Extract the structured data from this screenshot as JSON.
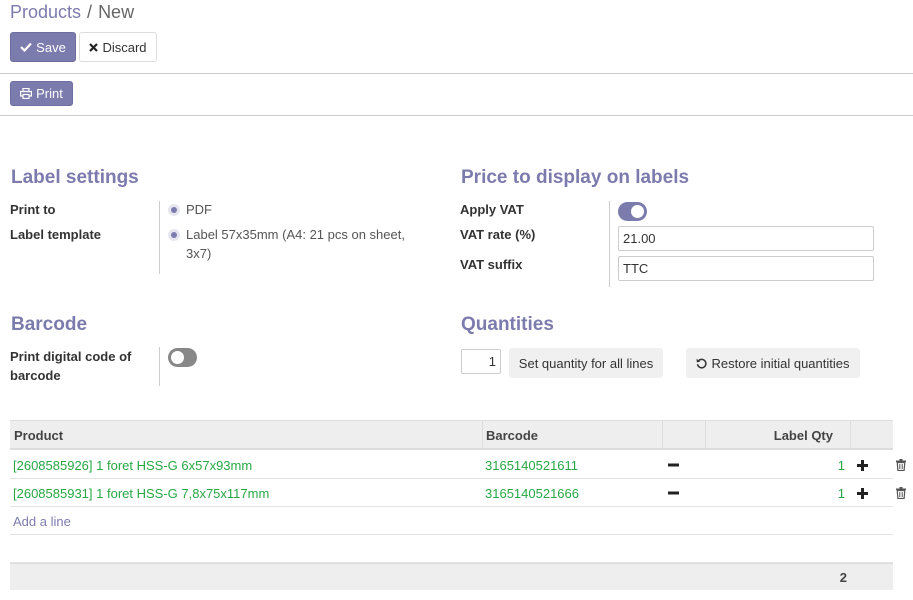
{
  "breadcrumb": {
    "parent": "Products",
    "separator": "/",
    "current": "New"
  },
  "control_panel": {
    "save_label": "Save",
    "discard_label": "Discard",
    "print_label": "Print"
  },
  "label_settings": {
    "title": "Label settings",
    "print_to_label": "Print to",
    "print_to_value": "PDF",
    "template_label": "Label template",
    "template_value_line1": "Label 57x35mm (A4: 21 pcs on sheet,",
    "template_value_line2": "3x7)"
  },
  "price_display": {
    "title": "Price to display on labels",
    "apply_vat_label": "Apply VAT",
    "apply_vat_on": true,
    "vat_rate_label": "VAT rate (%)",
    "vat_rate_value": "21.00",
    "vat_suffix_label": "VAT suffix",
    "vat_suffix_value": "TTC"
  },
  "barcode": {
    "title": "Barcode",
    "print_digital_label_line1": "Print digital code of",
    "print_digital_label_line2": "barcode",
    "print_digital_on": false
  },
  "quantities": {
    "title": "Quantities",
    "qty_value": "1",
    "set_all_label": "Set quantity for all lines",
    "restore_label": "Restore initial quantities"
  },
  "table": {
    "columns": {
      "product": "Product",
      "barcode": "Barcode",
      "label_qty": "Label Qty"
    },
    "rows": [
      {
        "product": "[2608585926] 1 foret HSS-G 6x57x93mm",
        "barcode": "3165140521611",
        "qty": "1"
      },
      {
        "product": "[2608585931] 1 foret HSS-G 7,8x75x117mm",
        "barcode": "3165140521666",
        "qty": "1"
      }
    ],
    "add_line_label": "Add a line",
    "total": "2"
  },
  "icons": {
    "save": "check-icon",
    "discard": "times-icon",
    "print": "print-icon",
    "restore": "undo-icon",
    "decrement": "minus-icon",
    "increment": "plus-icon",
    "delete": "trash-icon"
  },
  "colors": {
    "brand": "#7c7bad",
    "link_green": "#28a745",
    "toggle_off": "#888888"
  }
}
